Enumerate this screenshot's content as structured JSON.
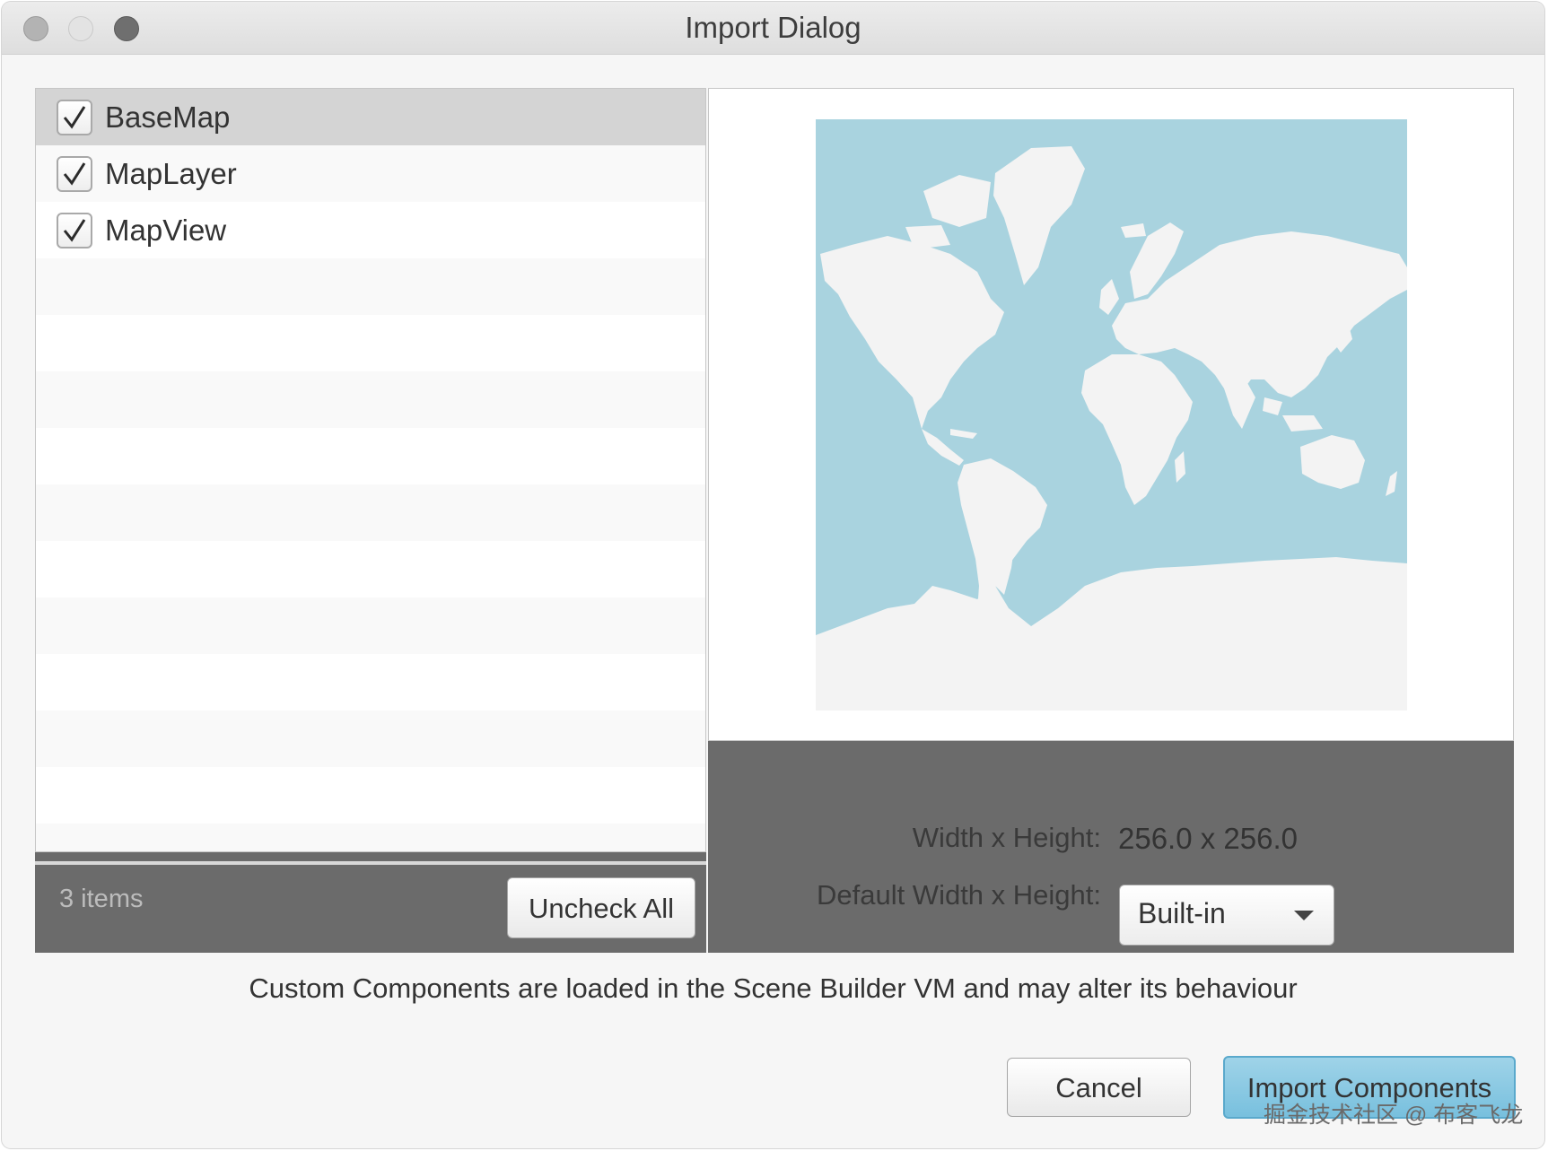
{
  "window": {
    "title": "Import Dialog"
  },
  "components": {
    "items": [
      {
        "label": "BaseMap",
        "checked": true,
        "selected": true
      },
      {
        "label": "MapLayer",
        "checked": true,
        "selected": false
      },
      {
        "label": "MapView",
        "checked": true,
        "selected": false
      }
    ],
    "count_label": "3 items",
    "uncheck_all_label": "Uncheck All"
  },
  "preview": {
    "size_label": "Width x Height:",
    "size_value": "256.0 x 256.0",
    "default_size_label": "Default Width x Height:",
    "default_size_value": "Built-in",
    "ocean_color": "#a9d3df",
    "land_color": "#f3f3f3"
  },
  "warning": "Custom Components are loaded in the Scene Builder VM and may alter its behaviour",
  "buttons": {
    "cancel": "Cancel",
    "import": "Import Components"
  },
  "watermark": "掘金技术社区 @ 布客飞龙"
}
